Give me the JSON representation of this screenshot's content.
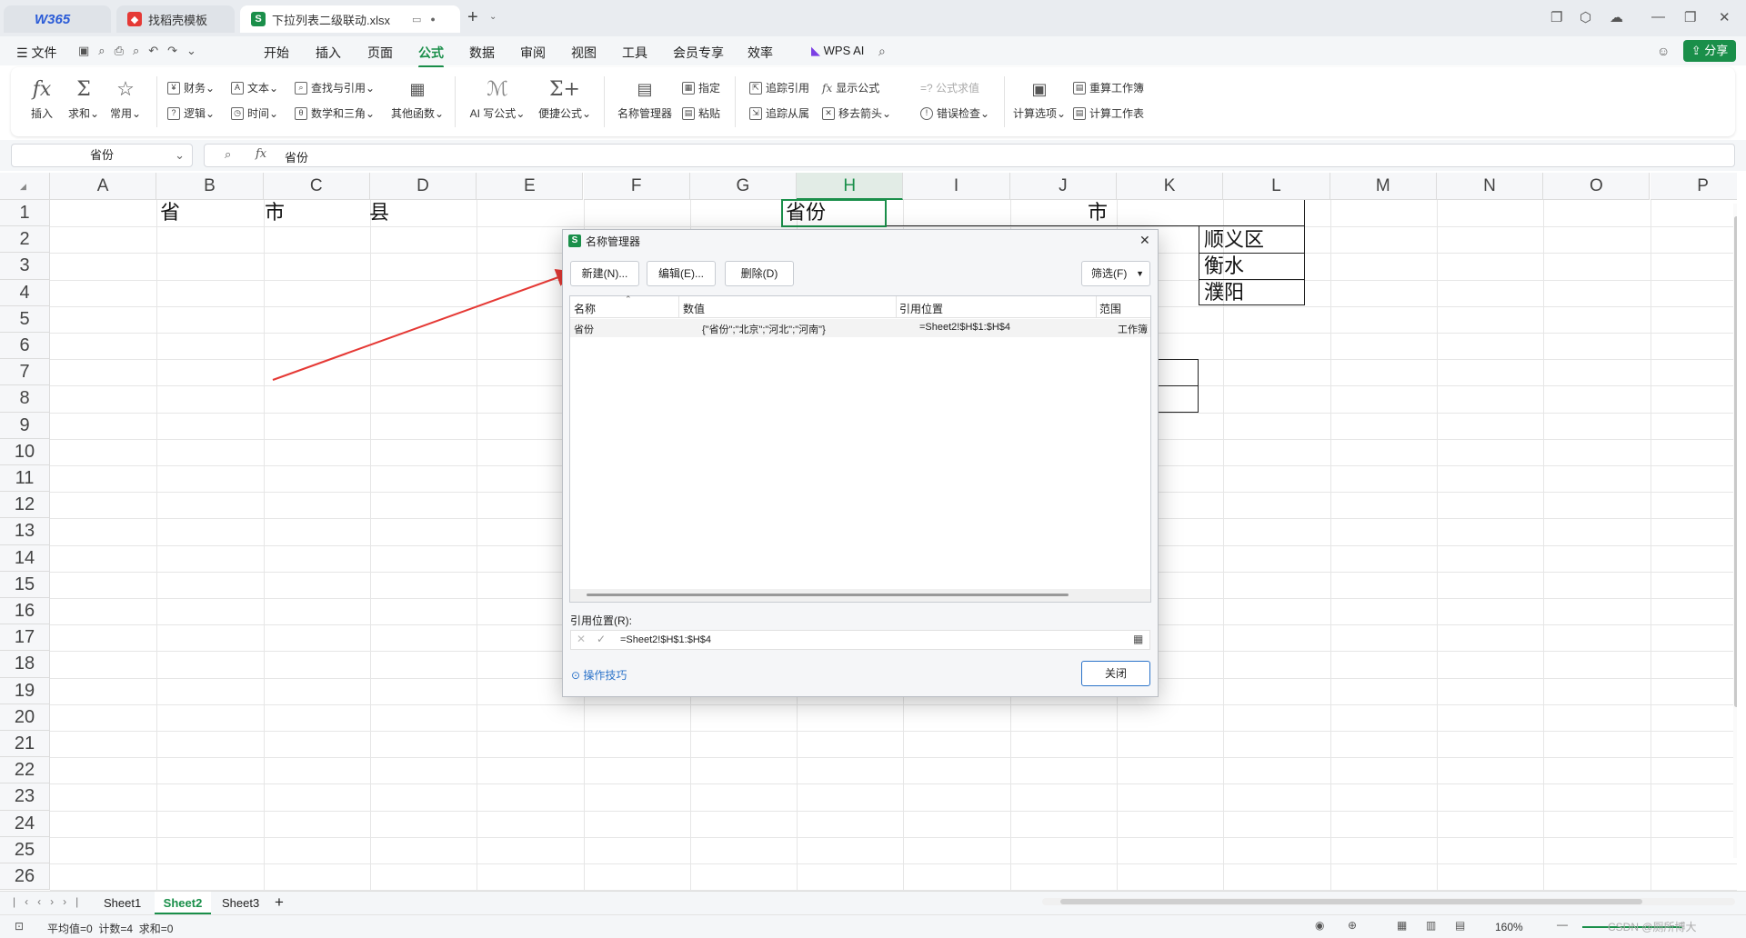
{
  "titlebar": {
    "tabs": [
      {
        "label": "W365",
        "active": false
      },
      {
        "label": "找稻壳模板",
        "active": false
      },
      {
        "label": "下拉列表二级联动.xlsx",
        "active": true
      }
    ],
    "new_tab": "+"
  },
  "menubar": {
    "file": "文件",
    "items": [
      "开始",
      "插入",
      "页面",
      "公式",
      "数据",
      "审阅",
      "视图",
      "工具",
      "会员专享",
      "效率"
    ],
    "active": "公式",
    "wps_ai": "WPS AI",
    "share": "分享"
  },
  "ribbon": {
    "big": [
      {
        "label": "插入",
        "icon": "fx-icon"
      },
      {
        "label": "求和",
        "icon": "sigma-icon"
      },
      {
        "label": "常用",
        "icon": "star-icon"
      }
    ],
    "func_rows": [
      [
        "财务",
        "文本",
        "查找与引用"
      ],
      [
        "逻辑",
        "时间",
        "数学和三角"
      ]
    ],
    "other_funcs": "其他函数",
    "ai_write": "AI 写公式",
    "quick_formula": "便捷公式",
    "name_manager": "名称管理器",
    "assign": "指定",
    "paste": "粘贴",
    "trace_precedents": "追踪引用",
    "trace_dependents": "追踪从属",
    "show_formula": "显示公式",
    "remove_arrows": "移去箭头",
    "formula_eval": "=? 公式求值",
    "error_check": "错误检查",
    "calc_options": "计算选项",
    "recalc_workbook": "重算工作簿",
    "calc_sheet": "计算工作表"
  },
  "formula_bar": {
    "name_box": "省份",
    "content": "省份"
  },
  "grid": {
    "columns": [
      "A",
      "B",
      "C",
      "D",
      "E",
      "F",
      "G",
      "H",
      "I",
      "J",
      "K",
      "L",
      "M",
      "N",
      "O",
      "P"
    ],
    "rows": [
      "1",
      "2",
      "3",
      "4",
      "5",
      "6",
      "7",
      "8",
      "9",
      "10",
      "11",
      "12",
      "13",
      "14",
      "15",
      "16",
      "17",
      "18",
      "19",
      "20",
      "21",
      "22",
      "23",
      "24",
      "25",
      "26"
    ],
    "cells": {
      "B1": "省",
      "C1": "市",
      "D1": "县",
      "H1": "省份",
      "J1": "市",
      "L2": "顺义区",
      "L3": "衡水",
      "L4": "濮阳"
    }
  },
  "dialog": {
    "title": "名称管理器",
    "btn_new": "新建(N)...",
    "btn_edit": "编辑(E)...",
    "btn_delete": "删除(D)",
    "btn_filter": "筛选(F)",
    "headers": [
      "名称",
      "数值",
      "引用位置",
      "范围"
    ],
    "rows": [
      {
        "name": "省份",
        "value": "{\"省份\";\"北京\";\"河北\";\"河南\"}",
        "ref": "=Sheet2!$H$1:$H$4",
        "scope": "工作簿"
      }
    ],
    "ref_label": "引用位置(R):",
    "ref_value": "=Sheet2!$H$1:$H$4",
    "tips": "操作技巧",
    "close": "关闭"
  },
  "sheets": [
    "Sheet1",
    "Sheet2",
    "Sheet3"
  ],
  "active_sheet": "Sheet2",
  "status": {
    "summary": "平均值=0  计数=4  求和=0",
    "zoom": "160%",
    "watermark": "CSDN @厕所博大"
  },
  "colors": {
    "accent": "#1a8f4a",
    "arrow": "#e53935"
  }
}
